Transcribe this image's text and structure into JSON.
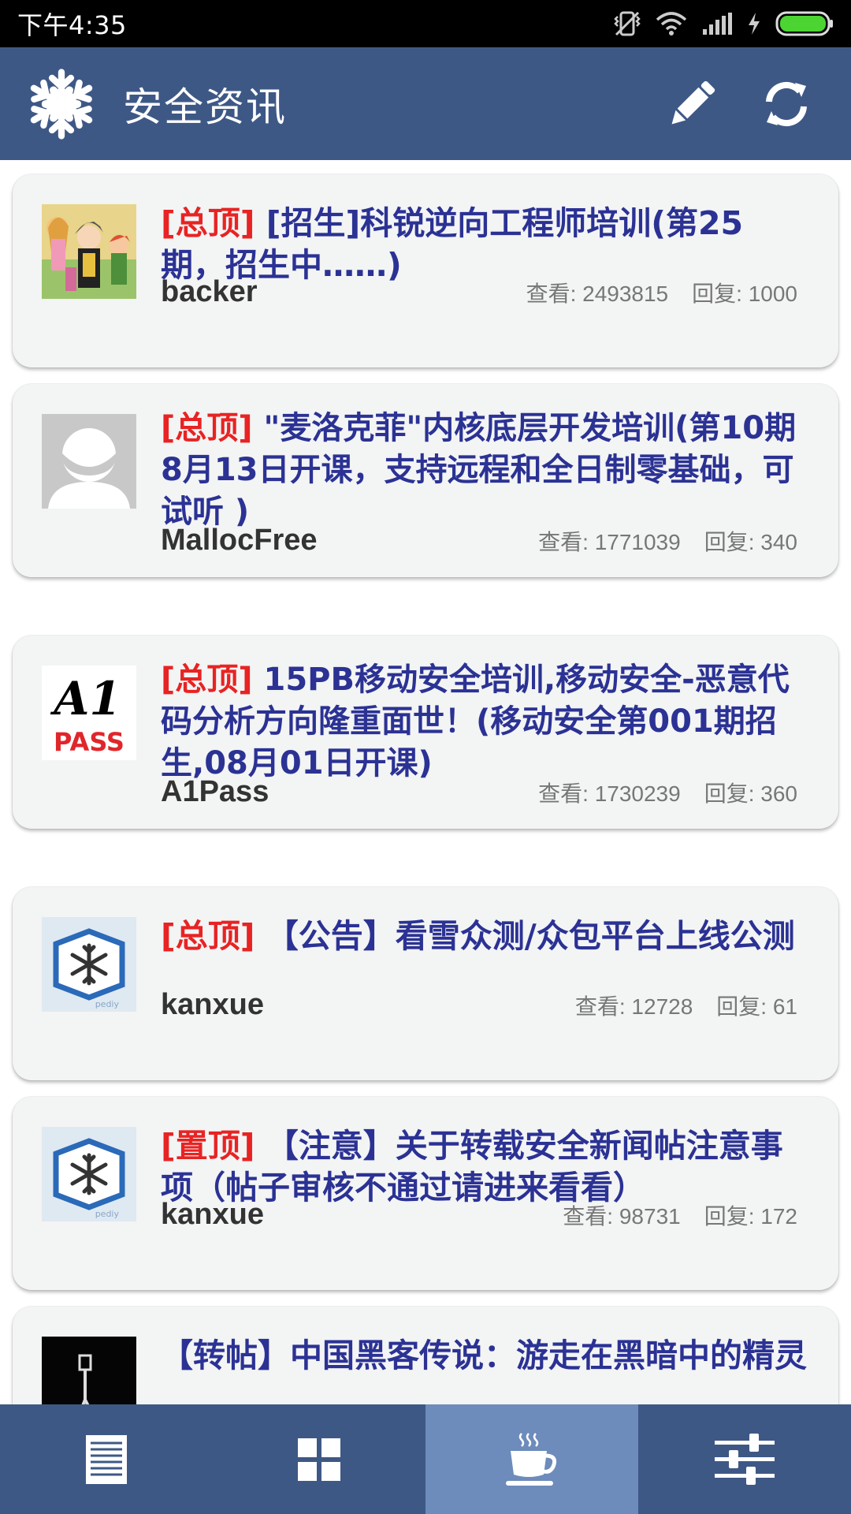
{
  "status_bar": {
    "time": "下午4:35"
  },
  "app_bar": {
    "title": "安全资讯"
  },
  "posts": [
    {
      "tag": "[总顶]",
      "title": " [招生]科锐逆向工程师培训(第25期，招生中……)",
      "author": "backer",
      "views": "查看: 2493815",
      "replies": "回复: 1000"
    },
    {
      "tag": "[总顶]",
      "title": " \"麦洛克菲\"内核底层开发培训(第10期8月13日开课，支持远程和全日制零基础，可试听 )",
      "author": "MallocFree",
      "views": "查看: 1771039",
      "replies": "回复: 340"
    },
    {
      "tag": "[总顶]",
      "title": " 15PB移动安全培训,移动安全-恶意代码分析方向隆重面世！(移动安全第001期招生,08月01日开课)",
      "author": "A1Pass",
      "views": "查看: 1730239",
      "replies": "回复: 360"
    },
    {
      "tag": "[总顶]",
      "title": " 【公告】看雪众测/众包平台上线公测",
      "author": "kanxue",
      "views": "查看: 12728",
      "replies": "回复: 61"
    },
    {
      "tag": "[置顶]",
      "title": " 【注意】关于转载安全新闻帖注意事项（帖子审核不通过请进来看看）",
      "author": "kanxue",
      "views": "查看: 98731",
      "replies": "回复: 172"
    },
    {
      "tag": "",
      "title": "【转帖】中国黑客传说：游走在黑暗中的精灵",
      "author": "",
      "views": "",
      "replies": ""
    }
  ],
  "avatar_texts": {
    "a1pass_top": "A1",
    "a1pass_bottom": "PASS",
    "pediy": "pediy"
  },
  "colors": {
    "app_bar": "#3e5886",
    "active_tab": "#6d8bbb",
    "title": "#2b3294",
    "tag": "#e82323"
  },
  "bottom_nav": [
    {
      "icon": "list-icon"
    },
    {
      "icon": "grid-icon"
    },
    {
      "icon": "coffee-icon",
      "active": true
    },
    {
      "icon": "sliders-icon"
    }
  ]
}
